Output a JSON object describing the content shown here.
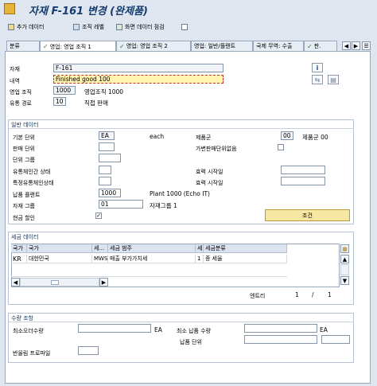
{
  "window": {
    "title": "자재 F-161 변경 (완제품)"
  },
  "toolbar": {
    "add_data": "추가 데이터",
    "org_level": "조직 레벨",
    "screen_check": "화면 데이터 점검"
  },
  "tabs": [
    {
      "label": "분류",
      "checked": false
    },
    {
      "label": "영업: 영업 조직 1",
      "checked": true,
      "active": true
    },
    {
      "label": "영업: 영업 조직 2",
      "checked": true
    },
    {
      "label": "영업: 일반/플랜트",
      "checked": false
    },
    {
      "label": "국제 무역: 수출",
      "checked": false
    },
    {
      "label": "판.",
      "checked": true
    }
  ],
  "header": {
    "material_label": "자재",
    "material_value": "F-161",
    "desc_label": "내역",
    "desc_value": "Finished good 100",
    "sales_org_label": "영업 조직",
    "sales_org_value": "1000",
    "sales_org_text": "영업조직 1000",
    "dist_channel_label": "유통 경로",
    "dist_channel_value": "10",
    "dist_channel_text": "직접 판매"
  },
  "general": {
    "title": "일반 데이터",
    "base_unit_label": "기본 단위",
    "base_unit_value": "EA",
    "base_unit_text": "each",
    "division_label": "제품군",
    "division_value": "00",
    "division_text": "제품군 00",
    "sales_unit_label": "판매 단위",
    "var_sales_unit_label": "가변판매단위없음",
    "unit_group_label": "단위 그룹",
    "xdist_status_label": "유통체인간 상태",
    "valid_from_label1": "효력 시작일",
    "dchain_status_label": "특정유통체인상태",
    "valid_from_label2": "효력 시작일",
    "delivering_plant_label": "납품 플랜트",
    "delivering_plant_value": "1000",
    "delivering_plant_text": "Plant 1000 (Echo IT)",
    "mat_group_label": "자재 그룹",
    "mat_group_value": "01",
    "mat_group_text": "자재그룹 1",
    "cash_discount_label": "현금 할인",
    "cash_discount_checked": "✓",
    "conditions_button": "조건"
  },
  "tax": {
    "title": "세금 데이터",
    "columns": [
      "국가",
      "국가",
      "세...",
      "세금 범주",
      "세...",
      "세금분류"
    ],
    "rows": [
      [
        "KR",
        "대한민국",
        "MWST",
        "매출 부가가치세",
        "1",
        "종 세율"
      ]
    ],
    "entry_label": "엔트리",
    "entry_current": "1",
    "entry_sep": "/",
    "entry_total": "1"
  },
  "quantity": {
    "title": "수량 조항",
    "min_order_label": "최소오더수량",
    "min_order_unit": "EA",
    "min_delivery_label": "최소 납품 수량",
    "min_delivery_unit": "EA",
    "delivery_unit_label": "납품 단위",
    "rounding_label": "반올림 프로파일"
  }
}
